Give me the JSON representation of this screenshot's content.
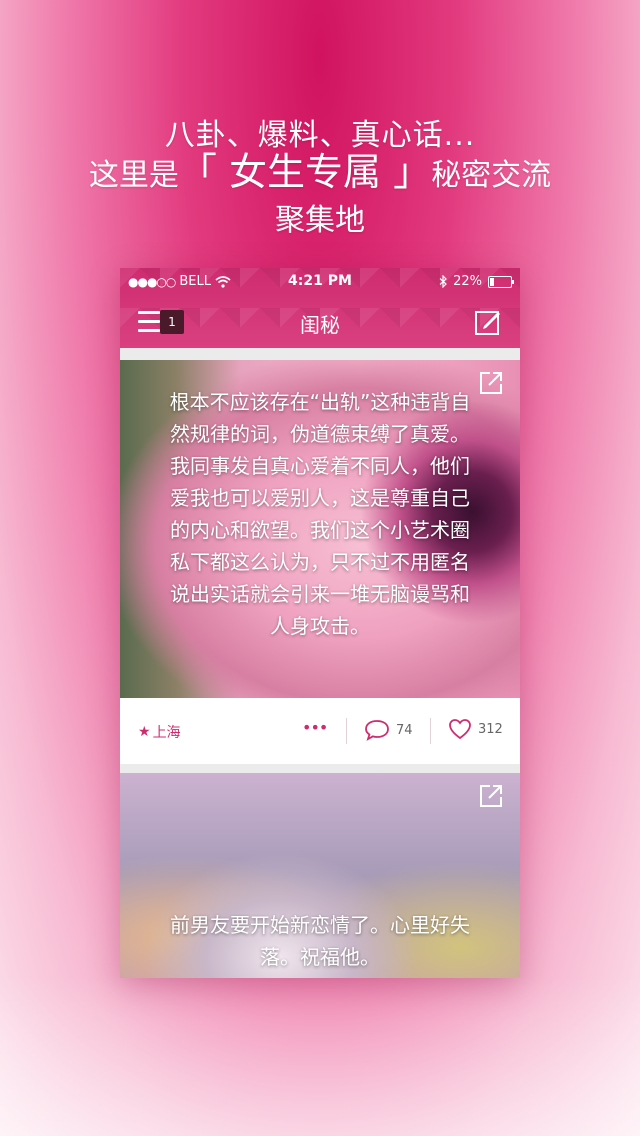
{
  "promo": {
    "line1": "八卦、爆料、真心话...",
    "line2_prefix": "这里是",
    "line2_highlight": "「 女生专属 」",
    "line2_suffix": "秘密交流",
    "line3": "聚集地"
  },
  "statusbar": {
    "signal": "●●●○○",
    "carrier": "BELL",
    "time": "4:21 PM",
    "battery": "22%",
    "battery_level": 0.22
  },
  "navbar": {
    "title": "闺秘",
    "badge_count": "1",
    "icons": {
      "menu": "menu-icon",
      "compose": "compose-icon"
    }
  },
  "posts": [
    {
      "text": "根本不应该存在“出轨”这种违背自然规律的词，伪道德束缚了真爱。我同事发自真心爱着不同人，他们爱我也可以爱别人，这是尊重自己的内心和欲望。我们这个小艺术圈私下都这么认为，只不过不用匿名说出实话就会引来一堆无脑谩骂和人身攻击。",
      "location": "上海",
      "more": "•••",
      "comments": "74",
      "likes": "312"
    },
    {
      "text": "前男友要开始新恋情了。心里好失落。祝福他。"
    }
  ],
  "colors": {
    "accent": "#cf2c70",
    "badge_bg": "#4a1a2a"
  }
}
